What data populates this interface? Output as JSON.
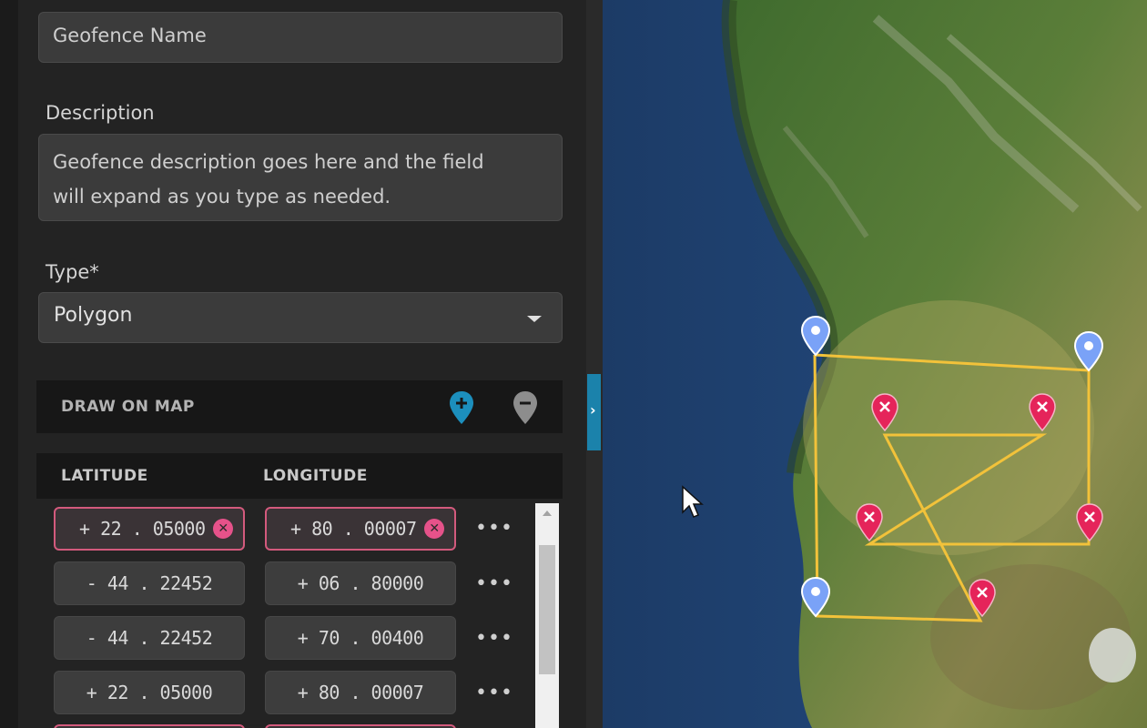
{
  "form": {
    "name_placeholder": "Geofence Name",
    "description_label": "Description",
    "description_value": "Geofence description goes here and the field will expand as you type as needed.",
    "description_line1": "Geofence description goes here and the field",
    "description_line2": "will expand as you type as needed.",
    "type_label": "Type*",
    "type_value": "Polygon"
  },
  "draw_on_map": {
    "label": "DRAW ON MAP",
    "add_point_icon": "add-location-pin-icon",
    "remove_point_icon": "remove-location-pin-icon"
  },
  "coords_table": {
    "headers": [
      "LATITUDE",
      "LONGITUDE"
    ],
    "rows": [
      {
        "latitude": "+ 22 . 05000",
        "longitude": "+ 80 . 00007",
        "invalid": true
      },
      {
        "latitude": "- 44 . 22452",
        "longitude": "+ 06 . 80000",
        "invalid": false
      },
      {
        "latitude": "- 44 . 22452",
        "longitude": "+ 70 . 00400",
        "invalid": false
      },
      {
        "latitude": "+ 22 . 05000",
        "longitude": "+ 80 . 00007",
        "invalid": false
      }
    ],
    "row_menu_glyph": "•••"
  },
  "map": {
    "valid_marker_color": "#7aa2f7",
    "invalid_marker_color": "#e5245a",
    "polygon_color": "#f2c23a"
  },
  "colors": {
    "accent": "#1b82ab",
    "error": "#d35a7d"
  }
}
